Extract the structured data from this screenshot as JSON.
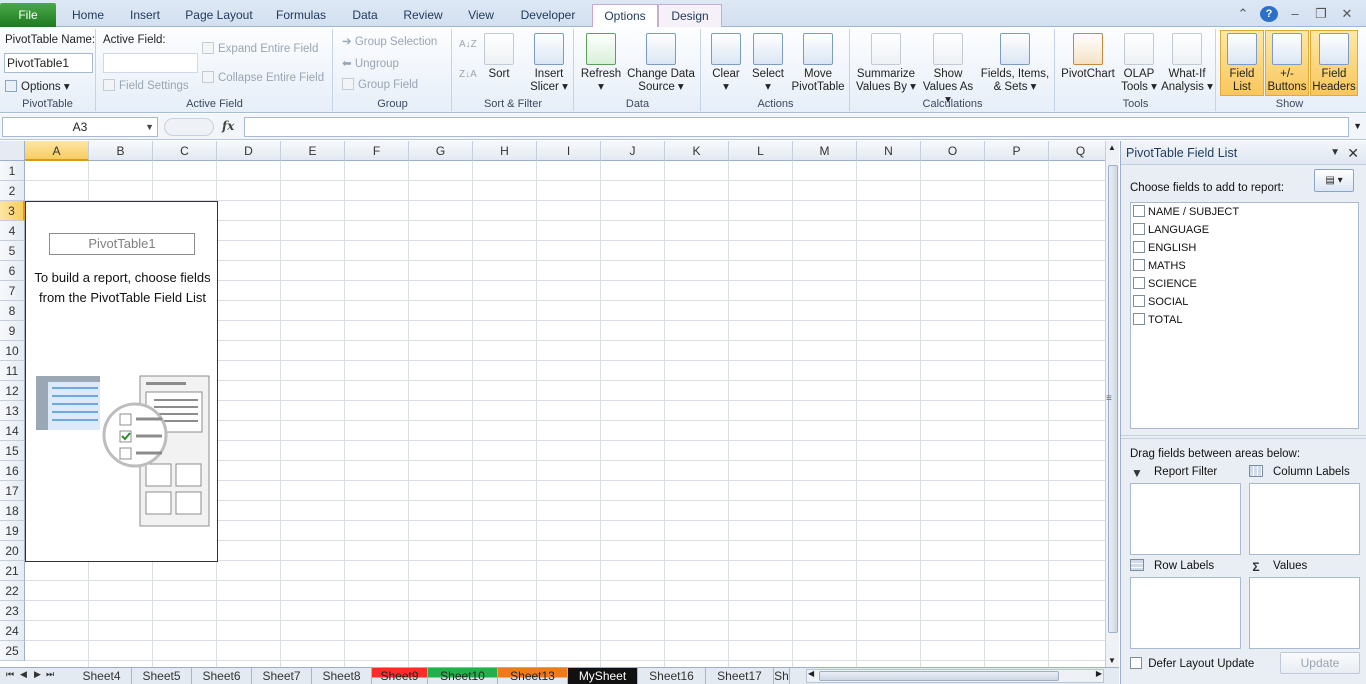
{
  "ribbon_tabs": [
    "File",
    "Home",
    "Insert",
    "Page Layout",
    "Formulas",
    "Data",
    "Review",
    "View",
    "Developer",
    "Options",
    "Design"
  ],
  "active_tab": "Options",
  "ribbon": {
    "pt_name_label": "PivotTable Name:",
    "pt_name_value": "PivotTable1",
    "options_btn": "Options",
    "pt_group": "PivotTable",
    "active_field_label": "Active Field:",
    "field_settings": "Field Settings",
    "expand_field": "Expand Entire Field",
    "collapse_field": "Collapse Entire Field",
    "active_field_group": "Active Field",
    "group_selection": "Group Selection",
    "ungroup": "Ungroup",
    "group_field": "Group Field",
    "group_group": "Group",
    "sort_btn": "Sort",
    "insert_slicer_1": "Insert",
    "insert_slicer_2": "Slicer",
    "sort_filter_group": "Sort & Filter",
    "refresh": "Refresh",
    "change_source_1": "Change Data",
    "change_source_2": "Source",
    "data_group": "Data",
    "clear": "Clear",
    "select": "Select",
    "move_1": "Move",
    "move_2": "PivotTable",
    "actions_group": "Actions",
    "summarize_1": "Summarize",
    "summarize_2": "Values By",
    "show_values_1": "Show",
    "show_values_2": "Values As",
    "fields_items_1": "Fields, Items,",
    "fields_items_2": "& Sets",
    "calculations_group": "Calculations",
    "pivotchart": "PivotChart",
    "olap_1": "OLAP",
    "olap_2": "Tools",
    "whatif_1": "What-If",
    "whatif_2": "Analysis",
    "tools_group": "Tools",
    "field_list_1": "Field",
    "field_list_2": "List",
    "buttons_1": "+/-",
    "buttons_2": "Buttons",
    "headers_1": "Field",
    "headers_2": "Headers",
    "show_group": "Show"
  },
  "formula_bar": {
    "name_box": "A3",
    "fx": "fx",
    "formula": ""
  },
  "grid": {
    "columns": [
      "A",
      "B",
      "C",
      "D",
      "E",
      "F",
      "G",
      "H",
      "I",
      "J",
      "K",
      "L",
      "M",
      "N",
      "O",
      "P",
      "Q"
    ],
    "rows": [
      "1",
      "2",
      "3",
      "4",
      "5",
      "6",
      "7",
      "8",
      "9",
      "10",
      "11",
      "12",
      "13",
      "14",
      "15",
      "16",
      "17",
      "18",
      "19",
      "20",
      "21",
      "22",
      "23",
      "24",
      "25"
    ],
    "selected_col": "A",
    "selected_row": "3"
  },
  "pivot_placeholder": {
    "name": "PivotTable1",
    "message": "To build a report, choose fields from the PivotTable Field List"
  },
  "sheet_tabs": [
    {
      "name": "Sheet4",
      "color": ""
    },
    {
      "name": "Sheet5",
      "color": ""
    },
    {
      "name": "Sheet6",
      "color": ""
    },
    {
      "name": "Sheet7",
      "color": ""
    },
    {
      "name": "Sheet8",
      "color": ""
    },
    {
      "name": "Sheet9",
      "color": "#ff2a2a"
    },
    {
      "name": "Sheet10",
      "color": "#22b04c"
    },
    {
      "name": "Sheet13",
      "color": "#f07a1a"
    },
    {
      "name": "MySheet",
      "color": "#111111"
    },
    {
      "name": "Sheet16",
      "color": ""
    },
    {
      "name": "Sheet17",
      "color": ""
    },
    {
      "name": "Sh",
      "color": ""
    }
  ],
  "field_list": {
    "title": "PivotTable Field List",
    "choose": "Choose fields to add to report:",
    "fields": [
      "NAME / SUBJECT",
      "LANGUAGE",
      "ENGLISH",
      "MATHS",
      "SCIENCE",
      "SOCIAL",
      "TOTAL"
    ],
    "drag": "Drag fields between areas below:",
    "report_filter": "Report Filter",
    "column_labels": "Column Labels",
    "row_labels": "Row Labels",
    "values": "Values",
    "sigma": "Σ",
    "defer": "Defer Layout Update",
    "update": "Update"
  }
}
